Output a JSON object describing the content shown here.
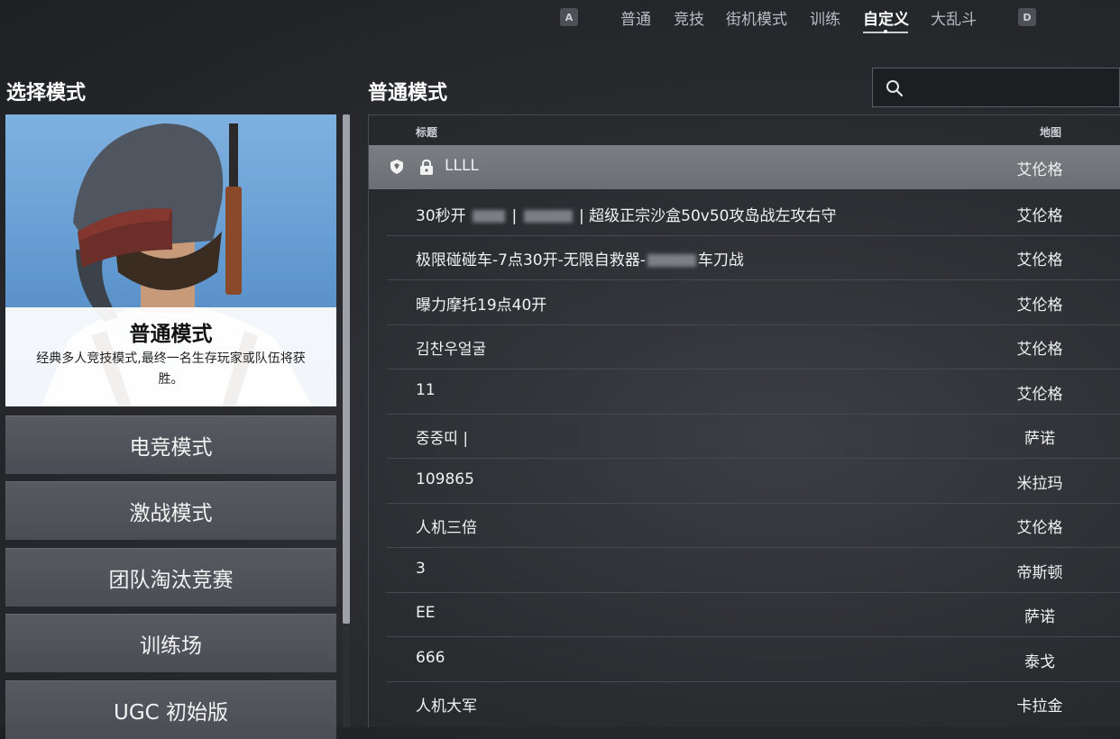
{
  "top_nav": {
    "left_key": "A",
    "right_key": "D",
    "tabs": [
      {
        "label": "普通"
      },
      {
        "label": "竞技"
      },
      {
        "label": "街机模式"
      },
      {
        "label": "训练"
      },
      {
        "label": "自定义"
      },
      {
        "label": "大乱斗"
      }
    ],
    "active_tab": "自定义"
  },
  "left_panel": {
    "title": "选择模式",
    "featured": {
      "title": "普通模式",
      "description": "经典多人竞技模式,最终一名生存玩家或队伍将获胜。"
    },
    "modes": [
      {
        "label": "电竞模式"
      },
      {
        "label": "激战模式"
      },
      {
        "label": "团队淘汰竞赛"
      },
      {
        "label": "训练场"
      },
      {
        "label": "UGC 初始版"
      }
    ]
  },
  "right_panel": {
    "title": "普通模式",
    "search": {
      "placeholder": "",
      "value": ""
    },
    "columns": {
      "title": "标题",
      "map": "地图"
    },
    "rows": [
      {
        "title": "LLLL",
        "map": "艾伦格",
        "selected": true,
        "locked": true
      },
      {
        "title_prefix": "30秒开",
        "title_mid": "|",
        "title_suffix": "| 超级正宗沙盒50v50攻岛战左攻右守",
        "map": "艾伦格"
      },
      {
        "title_prefix": "极限碰碰车-7点30开-无限自救器-",
        "title_suffix": "车刀战",
        "map": "艾伦格"
      },
      {
        "title": "曝力摩托19点40开",
        "map": "艾伦格"
      },
      {
        "title": "김찬우얼굴",
        "map": "艾伦格"
      },
      {
        "title": "11",
        "map": "艾伦格"
      },
      {
        "title": "중중띠 |",
        "map": "萨诺"
      },
      {
        "title": "109865",
        "map": "米拉玛"
      },
      {
        "title": "人机三倍",
        "map": "艾伦格"
      },
      {
        "title": "3",
        "map": "帝斯顿"
      },
      {
        "title": "EE",
        "map": "萨诺"
      },
      {
        "title": "666",
        "map": "泰戈"
      },
      {
        "title": "人机大军",
        "map": "卡拉金"
      }
    ]
  }
}
